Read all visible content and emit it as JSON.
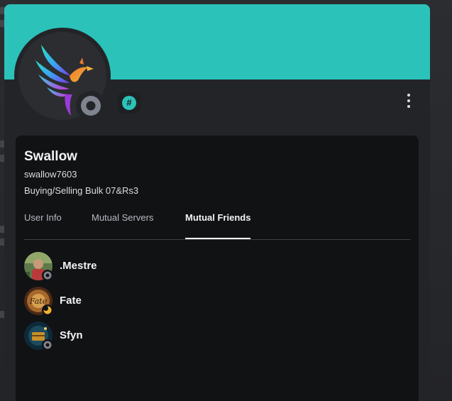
{
  "profile": {
    "display_name": "Swallow",
    "username": "swallow7603",
    "custom_status": "Buying/Selling Bulk 07&Rs3",
    "status": "offline",
    "server_tag_glyph": "#"
  },
  "colors": {
    "banner": "#2bc2b9",
    "card": "#232428",
    "panel": "#111214",
    "text_primary": "#f2f3f5",
    "text_muted": "#b5bac1",
    "status_offline": "#80848e",
    "status_idle": "#f0b232"
  },
  "icons": {
    "avatar": "phoenix-logo",
    "more": "more-vertical-icon",
    "server_tag": "server-tag-icon"
  },
  "tabs": [
    {
      "label": "User Info",
      "active": false
    },
    {
      "label": "Mutual Servers",
      "active": false
    },
    {
      "label": "Mutual Friends",
      "active": true
    }
  ],
  "mutual_friends": [
    {
      "name": ".Mestre",
      "status": "offline"
    },
    {
      "name": "Fate",
      "status": "idle"
    },
    {
      "name": "Sfyn",
      "status": "offline"
    }
  ]
}
